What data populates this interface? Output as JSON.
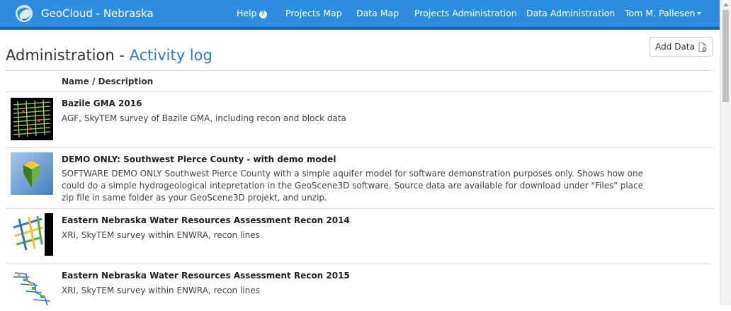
{
  "nav": {
    "brand": "GeoCloud - Nebraska",
    "help": "Help",
    "projects_map": "Projects Map",
    "data_map": "Data Map",
    "projects_admin": "Projects Administration",
    "data_admin": "Data Administration",
    "user": "Tom M. Pallesen"
  },
  "page": {
    "title": "Administration - ",
    "subtitle": "Activity log",
    "add_button": "Add Data"
  },
  "table": {
    "header": "Name / Description",
    "rows": [
      {
        "title": "Bazile GMA 2016",
        "description": "AGF, SkyTEM survey of Bazile GMA, including recon and block data",
        "thumb_icon": "survey-grid-thumbnail"
      },
      {
        "title": "DEMO ONLY: Southwest Pierce County - with demo model",
        "description": "SOFTWARE DEMO ONLY Southwest Pierce County with a simple aquifer model for software demonstration purposes only. Shows how one could do a simple hydrogeological intepretation in the GeoScene3D software. Source data are available for download under \"Files\" place zip file in same folder as your GeoScene3D projekt, and unzip.",
        "thumb_icon": "geoscene-logo-thumbnail"
      },
      {
        "title": "Eastern Nebraska Water Resources Assessment Recon 2014",
        "description": "XRI, SkyTEM survey within ENWRA, recon lines",
        "thumb_icon": "3d-model-thumbnail"
      },
      {
        "title": "Eastern Nebraska Water Resources Assessment Recon 2015",
        "description": "XRI, SkyTEM survey within ENWRA, recon lines",
        "thumb_icon": "flight-lines-thumbnail"
      }
    ]
  },
  "colors": {
    "navbar": "#2c8ee0",
    "navbar_border": "#1565b0",
    "accent": "#2c7bc4"
  }
}
